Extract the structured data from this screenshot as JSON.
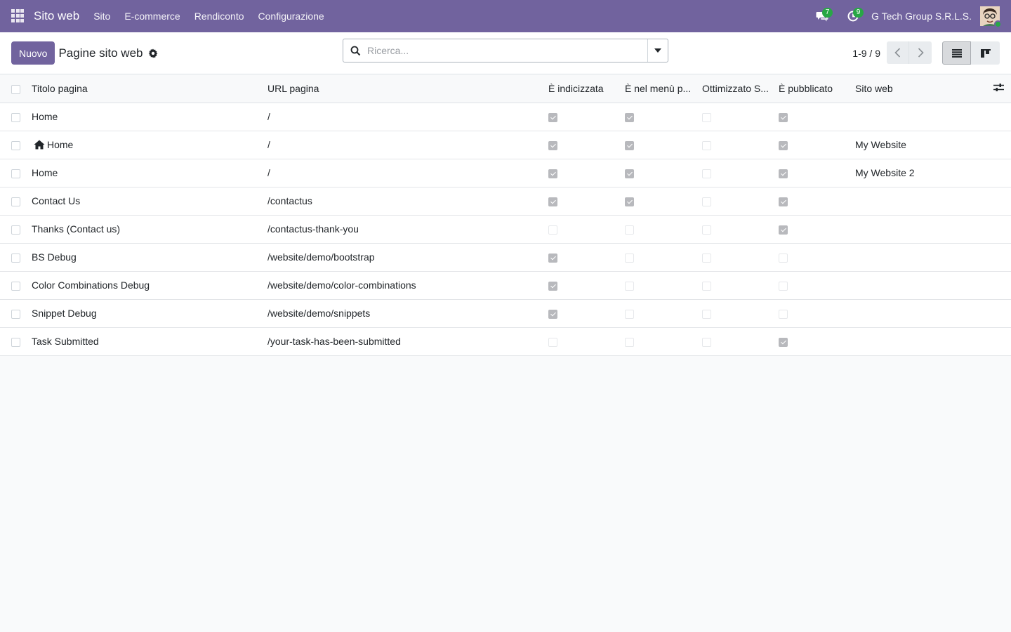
{
  "navbar": {
    "app_name": "Sito web",
    "menu": [
      "Sito",
      "E-commerce",
      "Rendiconto",
      "Configurazione"
    ],
    "messages_count": "7",
    "activities_count": "9",
    "company": "G Tech Group S.R.L.S.",
    "accent_color": "#71639e"
  },
  "control_panel": {
    "new_button": "Nuovo",
    "title": "Pagine sito web",
    "search_placeholder": "Ricerca...",
    "pager": "1-9 / 9"
  },
  "table": {
    "columns": [
      "Titolo pagina",
      "URL pagina",
      "È indicizzata",
      "È nel menù p...",
      "Ottimizzato S...",
      "È pubblicato",
      "Sito web"
    ],
    "rows": [
      {
        "title": "Home",
        "home_icon": false,
        "url": "/",
        "indexed": true,
        "in_menu": true,
        "seo": false,
        "published": true,
        "website": ""
      },
      {
        "title": "Home",
        "home_icon": true,
        "url": "/",
        "indexed": true,
        "in_menu": true,
        "seo": false,
        "published": true,
        "website": "My Website"
      },
      {
        "title": "Home",
        "home_icon": false,
        "url": "/",
        "indexed": true,
        "in_menu": true,
        "seo": false,
        "published": true,
        "website": "My Website 2"
      },
      {
        "title": "Contact Us",
        "home_icon": false,
        "url": "/contactus",
        "indexed": true,
        "in_menu": true,
        "seo": false,
        "published": true,
        "website": ""
      },
      {
        "title": "Thanks (Contact us)",
        "home_icon": false,
        "url": "/contactus-thank-you",
        "indexed": false,
        "in_menu": false,
        "seo": false,
        "published": true,
        "website": ""
      },
      {
        "title": "BS Debug",
        "home_icon": false,
        "url": "/website/demo/bootstrap",
        "indexed": true,
        "in_menu": false,
        "seo": false,
        "published": false,
        "website": ""
      },
      {
        "title": "Color Combinations Debug",
        "home_icon": false,
        "url": "/website/demo/color-combinations",
        "indexed": true,
        "in_menu": false,
        "seo": false,
        "published": false,
        "website": ""
      },
      {
        "title": "Snippet Debug",
        "home_icon": false,
        "url": "/website/demo/snippets",
        "indexed": true,
        "in_menu": false,
        "seo": false,
        "published": false,
        "website": ""
      },
      {
        "title": "Task Submitted",
        "home_icon": false,
        "url": "/your-task-has-been-submitted",
        "indexed": false,
        "in_menu": false,
        "seo": false,
        "published": true,
        "website": ""
      }
    ]
  }
}
